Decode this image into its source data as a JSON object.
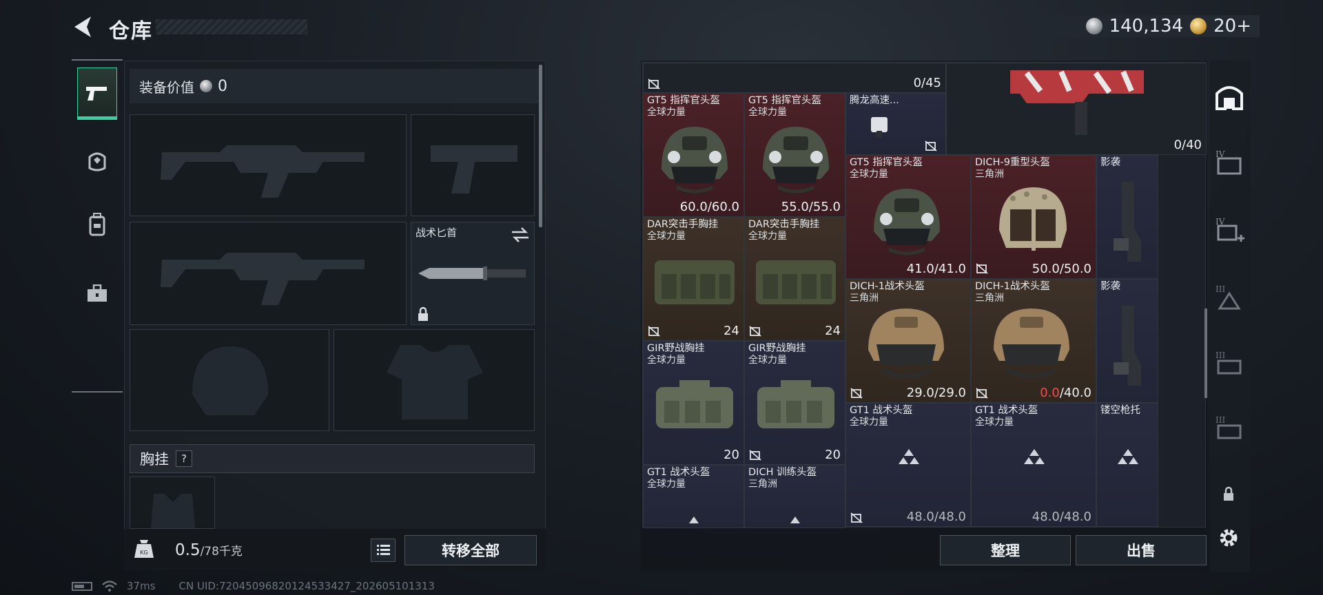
{
  "header": {
    "title": "仓库",
    "currency": [
      {
        "icon": "silver-coin-icon",
        "value": "140,134"
      },
      {
        "icon": "gold-coin-icon",
        "value": "20+"
      }
    ]
  },
  "left_tabs": [
    {
      "icon": "pistol-icon",
      "active": true
    },
    {
      "icon": "helmet-armor-icon",
      "active": false
    },
    {
      "icon": "backpack-icon",
      "active": false
    },
    {
      "icon": "briefcase-icon",
      "active": false
    }
  ],
  "equipment": {
    "value_label": "装备价值",
    "value": "0",
    "knife_slot_label": "战术匕首",
    "chest_label": "胸挂",
    "help": "?"
  },
  "weight": {
    "value": "0.5",
    "unit": "/78千克"
  },
  "buttons": {
    "transfer_all": "转移全部",
    "sort": "整理",
    "sell": "出售"
  },
  "stash": {
    "top_count": "0/45",
    "rifle_count": "0/40",
    "items": [
      {
        "name": "GT5 指挥官头盔",
        "sub": "全球力量",
        "value": "60.0/60.0"
      },
      {
        "name": "GT5 指挥官头盔",
        "sub": "全球力量",
        "value": "55.0/55.0"
      },
      {
        "name": "腾龙高速...",
        "sub": "",
        "value": ""
      },
      {
        "name": "GT5 指挥官头盔",
        "sub": "全球力量",
        "value": "41.0/41.0"
      },
      {
        "name": "DICH-9重型头盔",
        "sub": "三角洲",
        "value": "50.0/50.0"
      },
      {
        "name": "影袭",
        "sub": "",
        "value": ""
      },
      {
        "name": "DAR突击手胸挂",
        "sub": "全球力量",
        "value": "24"
      },
      {
        "name": "DAR突击手胸挂",
        "sub": "全球力量",
        "value": "24"
      },
      {
        "name": "DICH-1战术头盔",
        "sub": "三角洲",
        "value": "29.0/29.0"
      },
      {
        "name": "DICH-1战术头盔",
        "sub": "三角洲",
        "value_low": "0.0",
        "value_max": "/40.0"
      },
      {
        "name": "影袭",
        "sub": "",
        "value": ""
      },
      {
        "name": "GIR野战胸挂",
        "sub": "全球力量",
        "value": "20"
      },
      {
        "name": "GIR野战胸挂",
        "sub": "全球力量",
        "value": "20"
      },
      {
        "name": "GT1 战术头盔",
        "sub": "全球力量",
        "value": "48.0/48.0"
      },
      {
        "name": "GT1 战术头盔",
        "sub": "全球力量",
        "value": "48.0/48.0"
      },
      {
        "name": "镂空枪托",
        "sub": "",
        "value": ""
      },
      {
        "name": "GT1 战术头盔",
        "sub": "全球力量",
        "value": ""
      },
      {
        "name": "DICH 训练头盔",
        "sub": "三角洲",
        "value": ""
      }
    ]
  },
  "right_tabs": [
    "IV",
    "IV",
    "III",
    "III",
    "III"
  ],
  "status": {
    "ping": "37ms",
    "uid": "CN UID:720450968201245334​27_202605101313"
  }
}
